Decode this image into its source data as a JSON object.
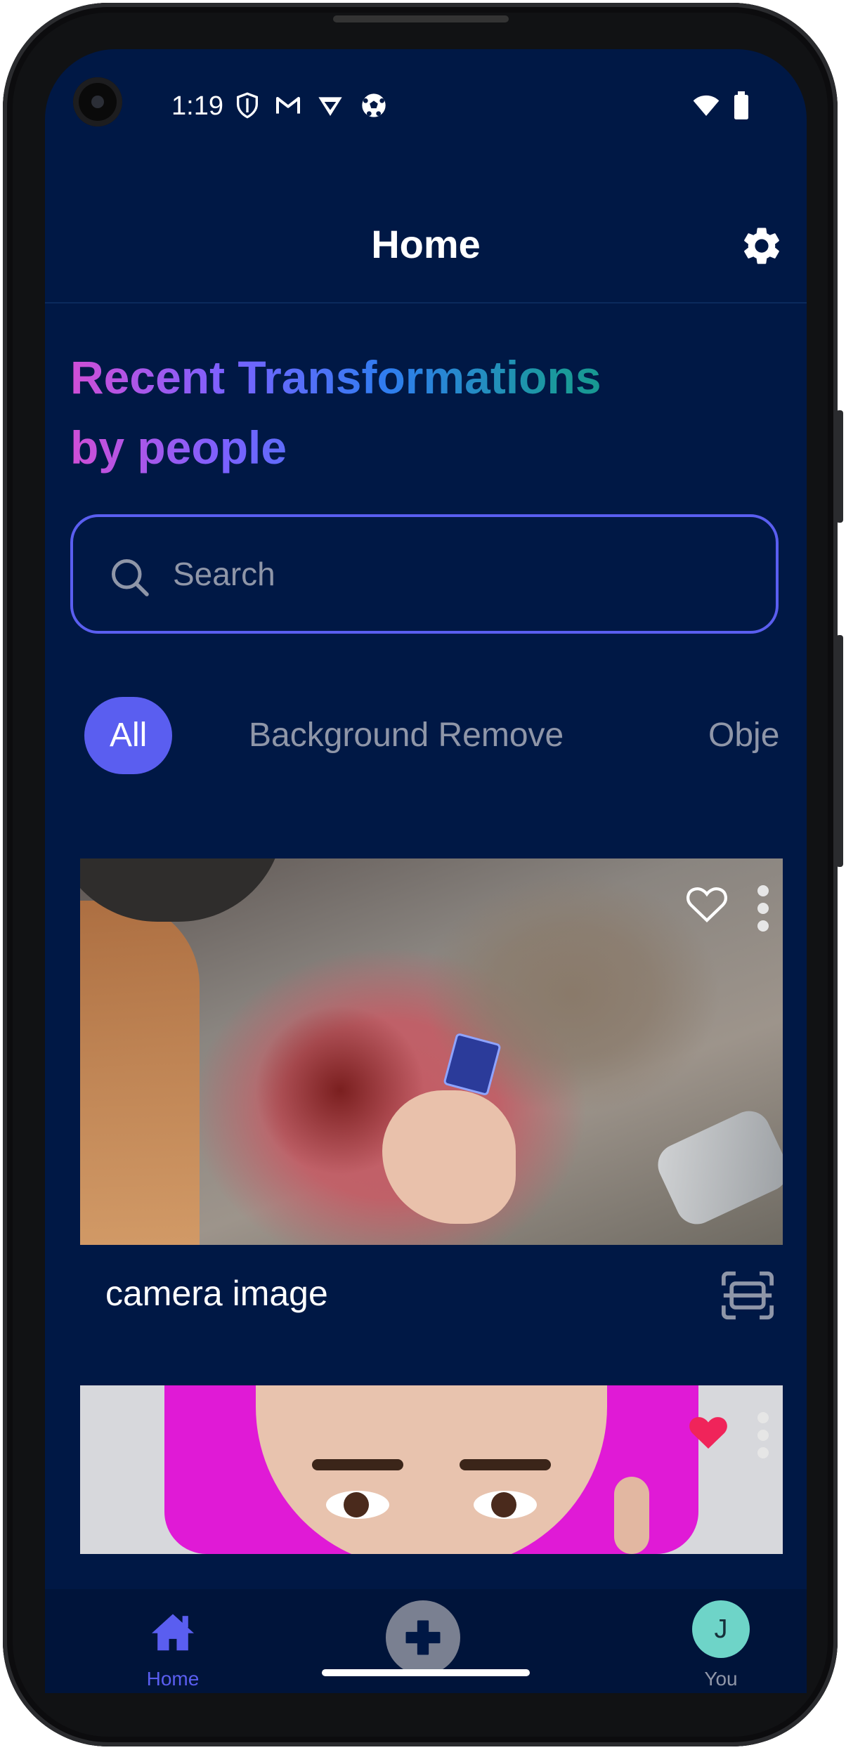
{
  "status_bar": {
    "time": "1:19",
    "left_icons": [
      "shield-icon",
      "gmail-icon",
      "vpn-badge-icon",
      "soccer-ball-icon"
    ],
    "right_icons": [
      "wifi-icon",
      "battery-icon"
    ]
  },
  "app_bar": {
    "title": "Home",
    "settings_icon": "gear-icon"
  },
  "content": {
    "heading_line1": "Recent Transformations",
    "heading_line2": "by people",
    "search": {
      "placeholder": "Search",
      "value": ""
    },
    "filters": [
      {
        "label": "All",
        "selected": true
      },
      {
        "label": "Background Remove",
        "selected": false
      },
      {
        "label": "Obje",
        "selected": false
      }
    ],
    "cards": [
      {
        "title": "camera image",
        "favorited": false,
        "action_icon": "scan-icon"
      },
      {
        "title": "",
        "favorited": true
      }
    ]
  },
  "bottom_nav": {
    "items": [
      {
        "label": "Home",
        "icon": "home-icon",
        "active": true
      },
      {
        "label": "",
        "icon": "add-icon",
        "active": false
      },
      {
        "label": "You",
        "icon": "avatar",
        "avatar_letter": "J",
        "active": false
      }
    ]
  },
  "colors": {
    "background": "#001845",
    "accent": "#5a5ef0",
    "heart_active": "#f0245a",
    "muted_text": "#8f96a8"
  }
}
